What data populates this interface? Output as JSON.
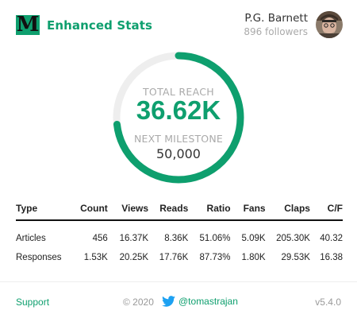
{
  "brand": {
    "logo_letter": "M",
    "name": "Enhanced Stats"
  },
  "user": {
    "name": "P.G. Barnett",
    "followers": "896 followers"
  },
  "gauge": {
    "reach_label": "TOTAL REACH",
    "reach_value": "36.62K",
    "milestone_label": "NEXT MILESTONE",
    "milestone_value": "50,000",
    "progress_fraction": 0.7324
  },
  "table": {
    "headers": [
      "Type",
      "Count",
      "Views",
      "Reads",
      "Ratio",
      "Fans",
      "Claps",
      "C/F"
    ],
    "rows": [
      [
        "Articles",
        "456",
        "16.37K",
        "8.36K",
        "51.06%",
        "5.09K",
        "205.30K",
        "40.32"
      ],
      [
        "Responses",
        "1.53K",
        "20.25K",
        "17.76K",
        "87.73%",
        "1.80K",
        "29.53K",
        "16.38"
      ]
    ]
  },
  "footer": {
    "support_label": "Support",
    "copyright": "© 2020",
    "twitter_handle": "@tomastrajan",
    "version": "v5.4.0"
  },
  "colors": {
    "accent": "#0e9f6e",
    "track": "#eeeeee",
    "muted": "#aaaaaa"
  }
}
